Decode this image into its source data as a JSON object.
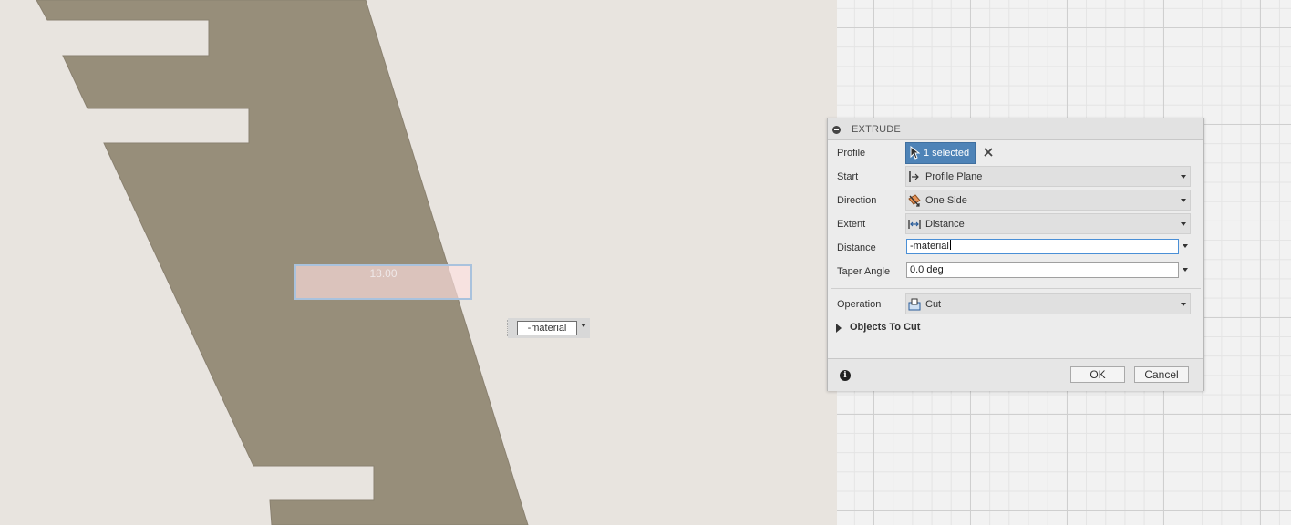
{
  "viewport": {
    "dimension_value": "18.00",
    "quick_input": "-material"
  },
  "panel": {
    "title": "EXTRUDE",
    "rows": {
      "profile": {
        "label": "Profile",
        "value": "1 selected"
      },
      "start": {
        "label": "Start",
        "value": "Profile Plane"
      },
      "direction": {
        "label": "Direction",
        "value": "One Side"
      },
      "extent": {
        "label": "Extent",
        "value": "Distance"
      },
      "distance": {
        "label": "Distance",
        "value": "-material"
      },
      "taper": {
        "label": "Taper Angle",
        "value": "0.0 deg"
      },
      "operation": {
        "label": "Operation",
        "value": "Cut"
      }
    },
    "objects_to_cut": "Objects To Cut",
    "ok_label": "OK",
    "cancel_label": "Cancel"
  },
  "colors": {
    "sketch_fill": "#978e7a",
    "background": "#e8e4df",
    "selected_button": "#4e83b7",
    "focus_border": "#4a8fd6"
  },
  "icons": [
    "collapse-icon",
    "cursor-icon",
    "clear-icon",
    "start-plane-icon",
    "direction-icon",
    "extent-distance-icon",
    "cut-operation-icon",
    "expand-triangle-icon",
    "info-icon"
  ]
}
